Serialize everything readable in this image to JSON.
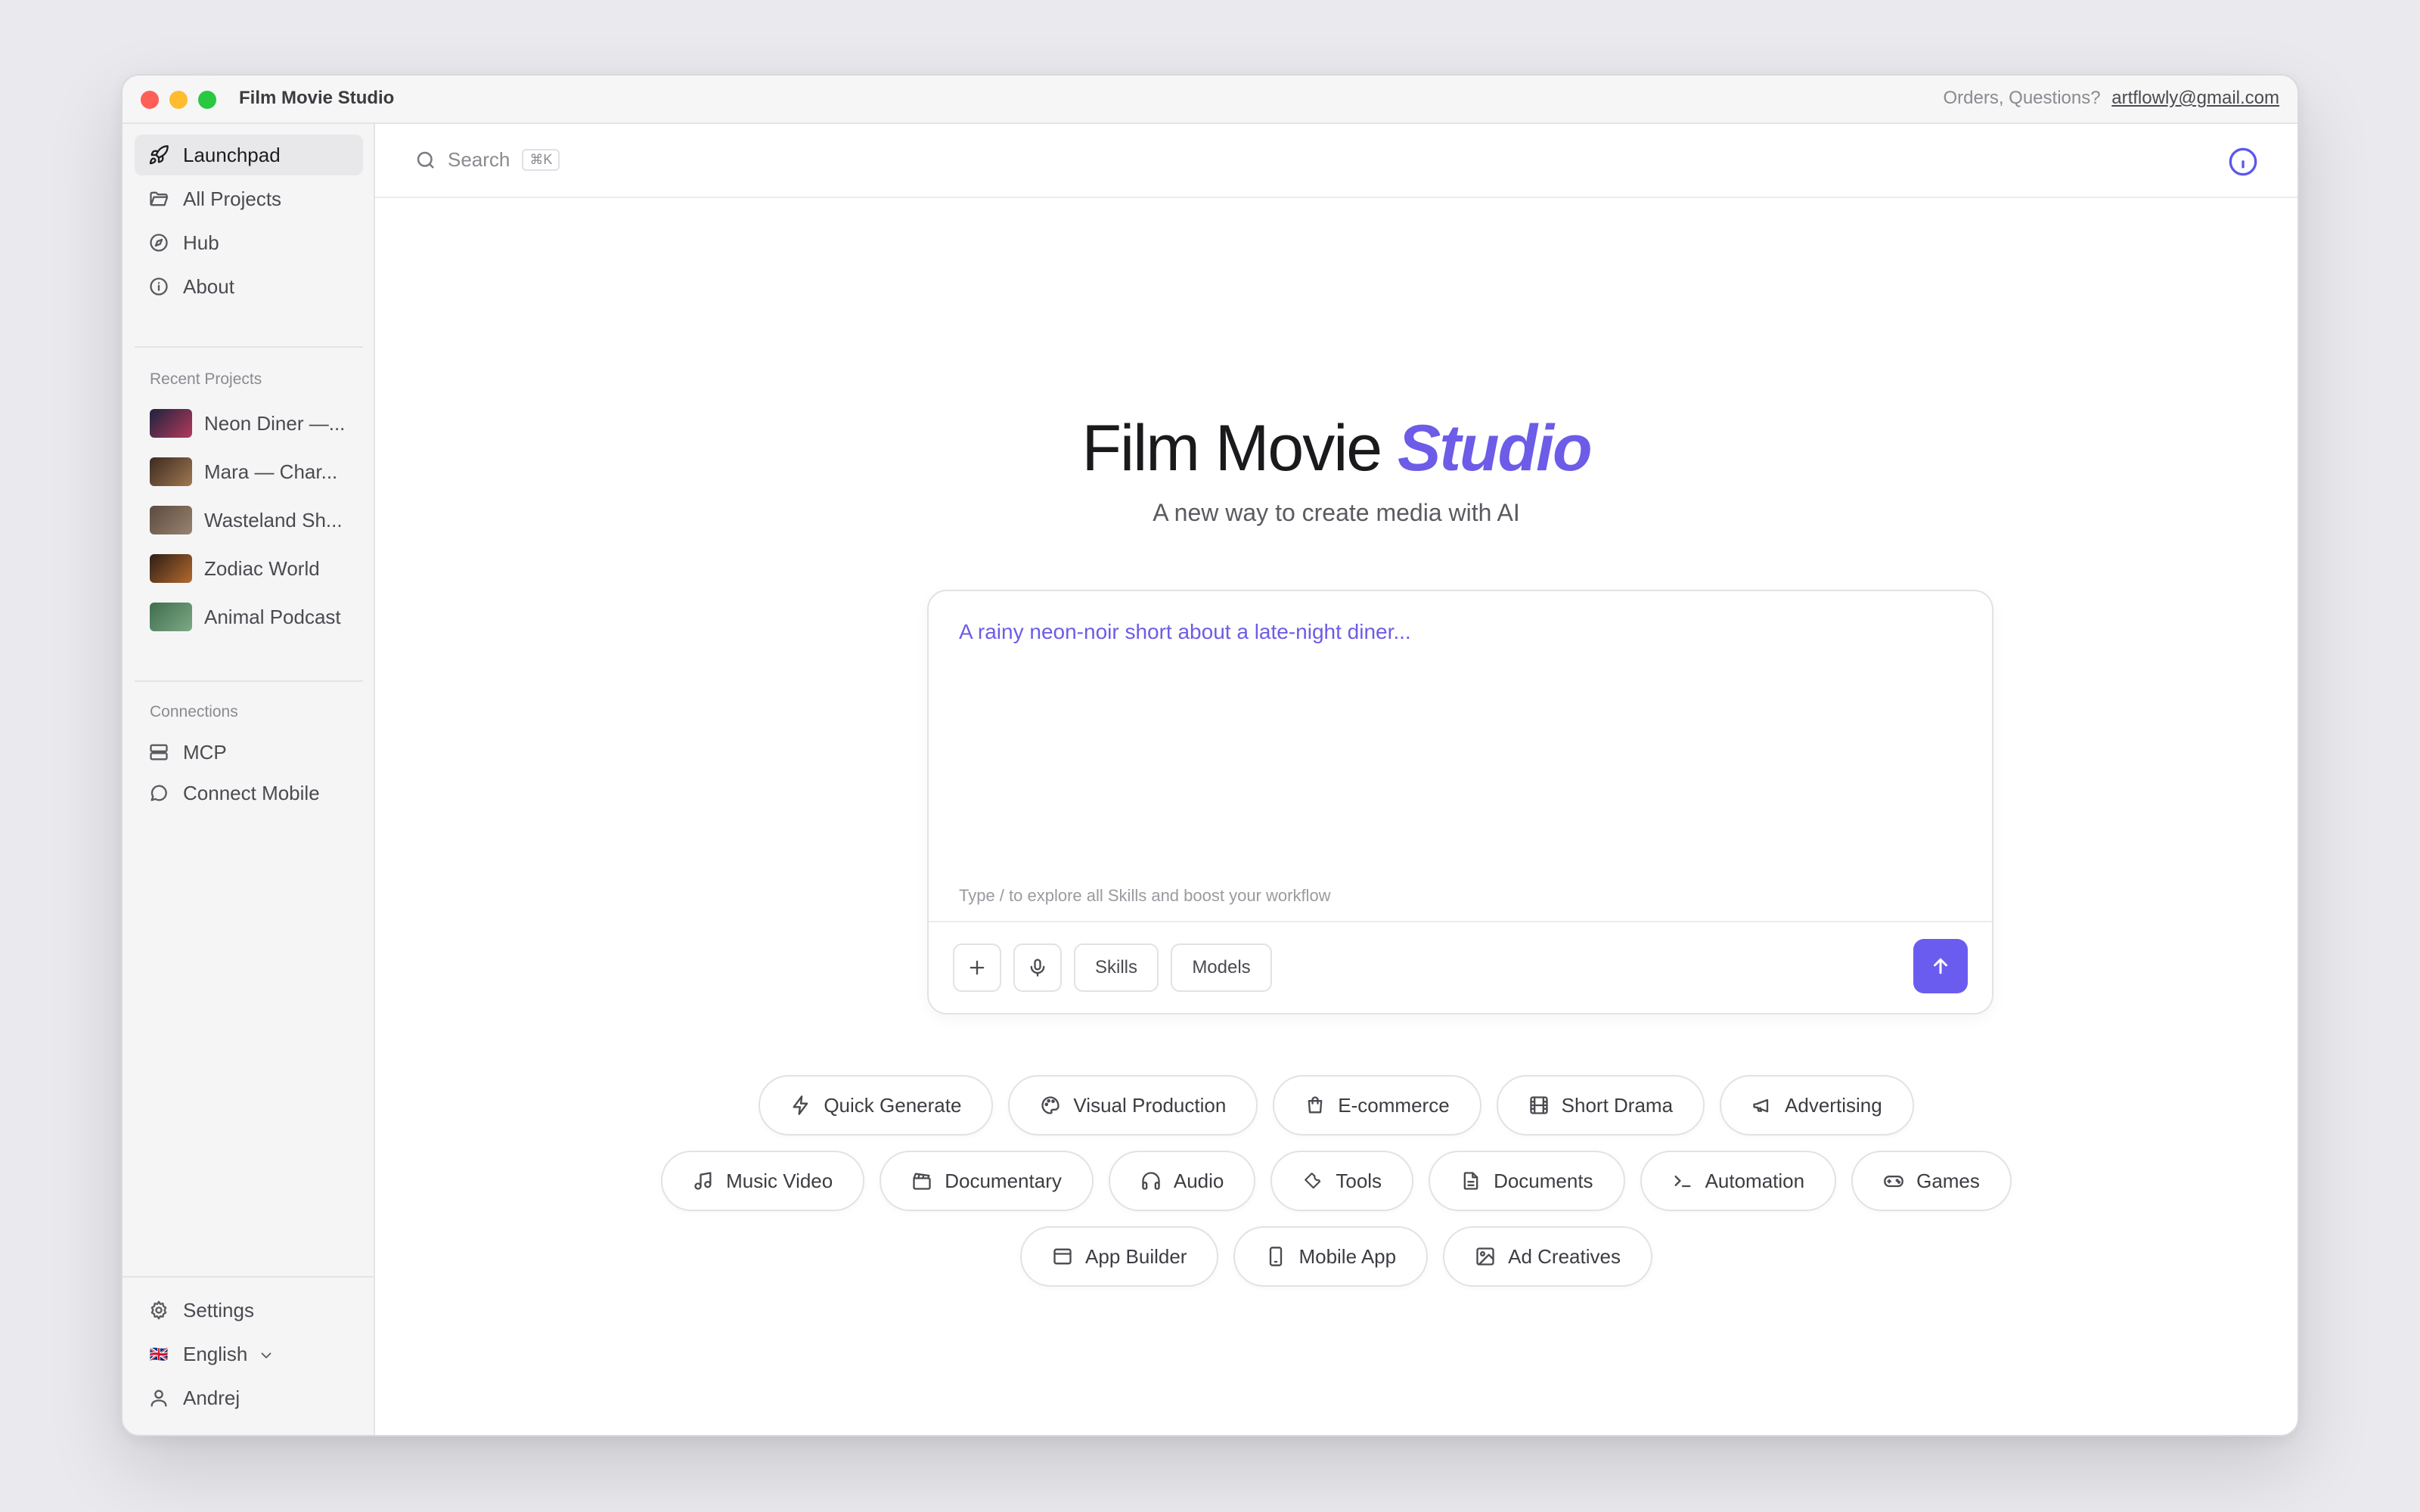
{
  "window": {
    "title": "Film Movie Studio",
    "contact_prefix": "Orders, Questions?",
    "contact_email": "artflowly@gmail.com"
  },
  "sidebar": {
    "nav": [
      {
        "label": "Launchpad",
        "icon": "rocket-icon",
        "active": true
      },
      {
        "label": "All Projects",
        "icon": "folder-icon"
      },
      {
        "label": "Hub",
        "icon": "compass-icon"
      },
      {
        "label": "About",
        "icon": "info-icon"
      }
    ],
    "recent_label": "Recent Projects",
    "recent": [
      {
        "label": "Neon Diner —...",
        "thumb_colors": [
          "#1d2340",
          "#b33a5a"
        ]
      },
      {
        "label": "Mara — Char...",
        "thumb_colors": [
          "#3b2a22",
          "#a07850"
        ]
      },
      {
        "label": "Wasteland Sh...",
        "thumb_colors": [
          "#5a4a3e",
          "#9a8370"
        ]
      },
      {
        "label": "Zodiac World",
        "thumb_colors": [
          "#2e1e16",
          "#b36a2e"
        ]
      },
      {
        "label": "Animal Podcast",
        "thumb_colors": [
          "#3f6e4e",
          "#7da885"
        ]
      }
    ],
    "connections_label": "Connections",
    "connections": [
      {
        "label": "MCP",
        "icon": "server-icon"
      },
      {
        "label": "Connect Mobile",
        "icon": "chat-icon"
      }
    ],
    "bottom": {
      "settings": "Settings",
      "language": "English",
      "language_flag": "🇬🇧",
      "user": "Andrej"
    }
  },
  "search": {
    "placeholder": "Search",
    "shortcut": "⌘K"
  },
  "hero": {
    "title_main": "Film Movie",
    "title_accent": "Studio",
    "subtitle": "A new way to create media with AI"
  },
  "composer": {
    "prompt": "A rainy neon-noir short about a late-night diner...",
    "hint": "Type / to explore all Skills and boost your workflow",
    "skills_label": "Skills",
    "models_label": "Models"
  },
  "chips": [
    [
      {
        "label": "Quick Generate",
        "icon": "bolt-icon"
      },
      {
        "label": "Visual Production",
        "icon": "palette-icon"
      },
      {
        "label": "E-commerce",
        "icon": "shopping-bag-icon"
      },
      {
        "label": "Short Drama",
        "icon": "film-icon"
      },
      {
        "label": "Advertising",
        "icon": "megaphone-icon"
      }
    ],
    [
      {
        "label": "Music Video",
        "icon": "music-note-icon"
      },
      {
        "label": "Documentary",
        "icon": "clapperboard-icon"
      },
      {
        "label": "Audio",
        "icon": "headphones-icon"
      },
      {
        "label": "Tools",
        "icon": "wrench-icon"
      },
      {
        "label": "Documents",
        "icon": "document-icon"
      },
      {
        "label": "Automation",
        "icon": "terminal-icon"
      },
      {
        "label": "Games",
        "icon": "gamepad-icon"
      }
    ],
    [
      {
        "label": "App Builder",
        "icon": "browser-window-icon"
      },
      {
        "label": "Mobile App",
        "icon": "phone-icon"
      },
      {
        "label": "Ad Creatives",
        "icon": "image-icon"
      }
    ]
  ],
  "colors": {
    "accent": "#6c5ce7",
    "send_button": "#6b5cf0",
    "info_icon": "#5b57f0"
  }
}
